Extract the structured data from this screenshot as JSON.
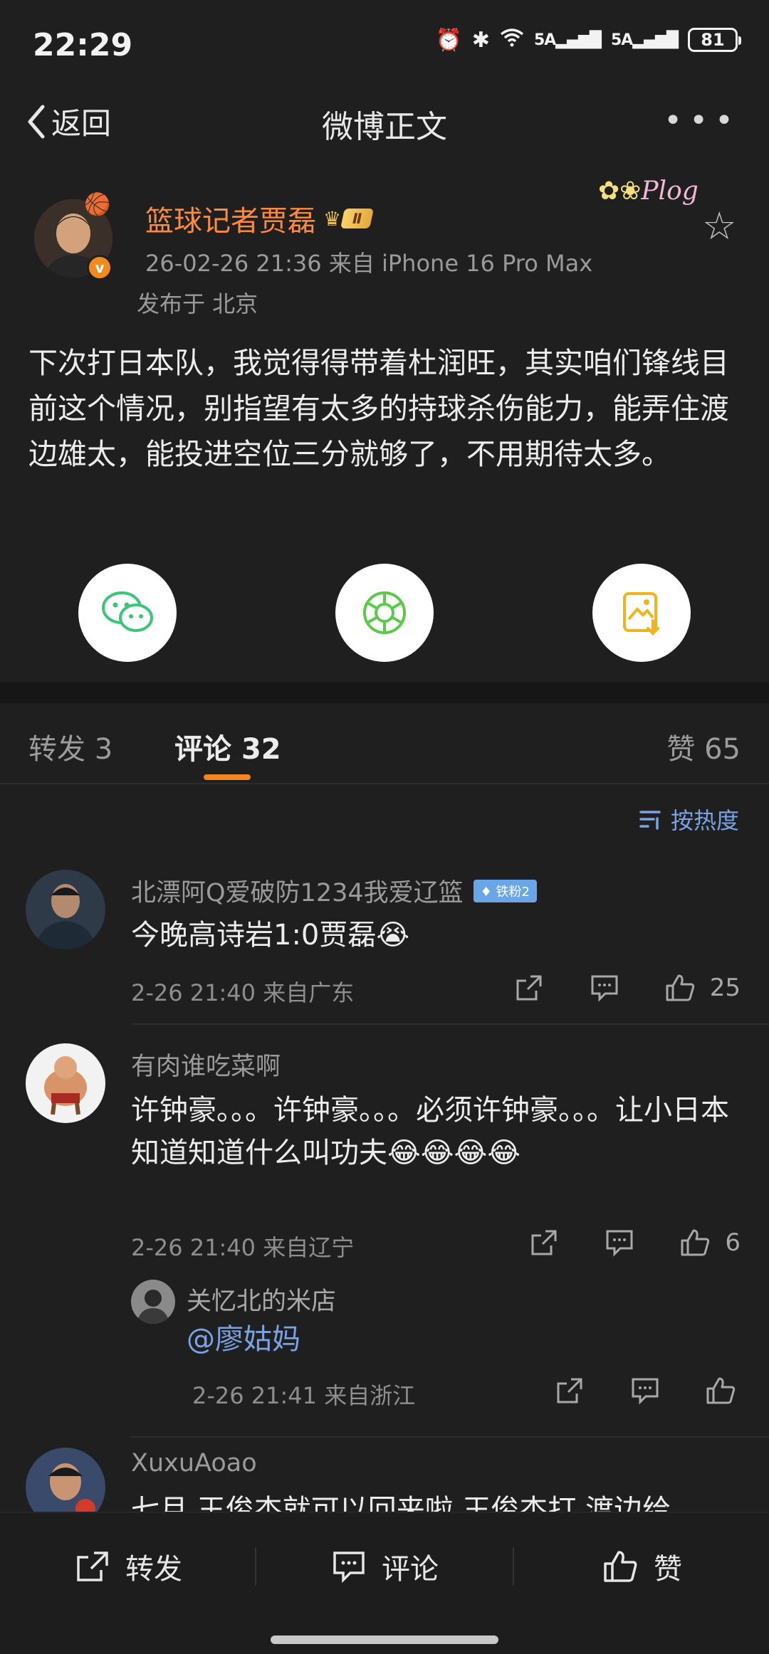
{
  "status_bar": {
    "time": "22:29",
    "signal1": "5A",
    "signal2": "5A",
    "battery": "81"
  },
  "nav": {
    "back_label": "返回",
    "title": "微博正文",
    "more_icon": "more-icon"
  },
  "post": {
    "author": "篮球记者贾磊",
    "level_tag": "Ⅱ",
    "meta": "26-02-26 21:36  来自 iPhone 16 Pro Max",
    "location": "发布于 北京",
    "plog_badge": "Plog",
    "body": "下次打日本队，我觉得得带着杜润旺，其实咱们锋线目前这个情况，别指望有太多的持球杀伤能力，能弄住渡边雄太，能投进空位三分就够了，不用期待太多。",
    "share_buttons": [
      "wechat-icon",
      "moments-icon",
      "save-image-icon"
    ]
  },
  "tabs": {
    "repost": "转发 3",
    "comment_label": "评论",
    "comment_count": "32",
    "likes": "赞 65"
  },
  "sort": {
    "label": "按热度"
  },
  "comments": [
    {
      "name": "北漂阿Q爱破防1234我爱辽篮",
      "badge": "铁粉2",
      "text": "今晚高诗岩1:0贾磊😭",
      "meta": "2-26 21:40 来自广东",
      "likes": "25"
    },
    {
      "name": "有肉谁吃菜啊",
      "text": "许钟豪。。。许钟豪。。。必须许钟豪。。。让小日本知道知道什么叫功夫😂😂😂😂",
      "meta": "2-26 21:40 来自辽宁",
      "likes": "6"
    },
    {
      "name": "关忆北的米店",
      "text": "@廖姑妈",
      "meta": "2-26 21:41 来自浙江",
      "likes": ""
    },
    {
      "name": "XuxuAoao",
      "text": "七月 王俊杰就可以回来啦 王俊杰打 渡边给"
    }
  ],
  "bottom_bar": {
    "repost": "转发",
    "comment": "评论",
    "like": "赞"
  },
  "colors": {
    "background": "#1f1f1f",
    "author_orange": "#ff8a3d",
    "accent_orange": "#f5861f",
    "link_blue": "#7aa3e6"
  }
}
